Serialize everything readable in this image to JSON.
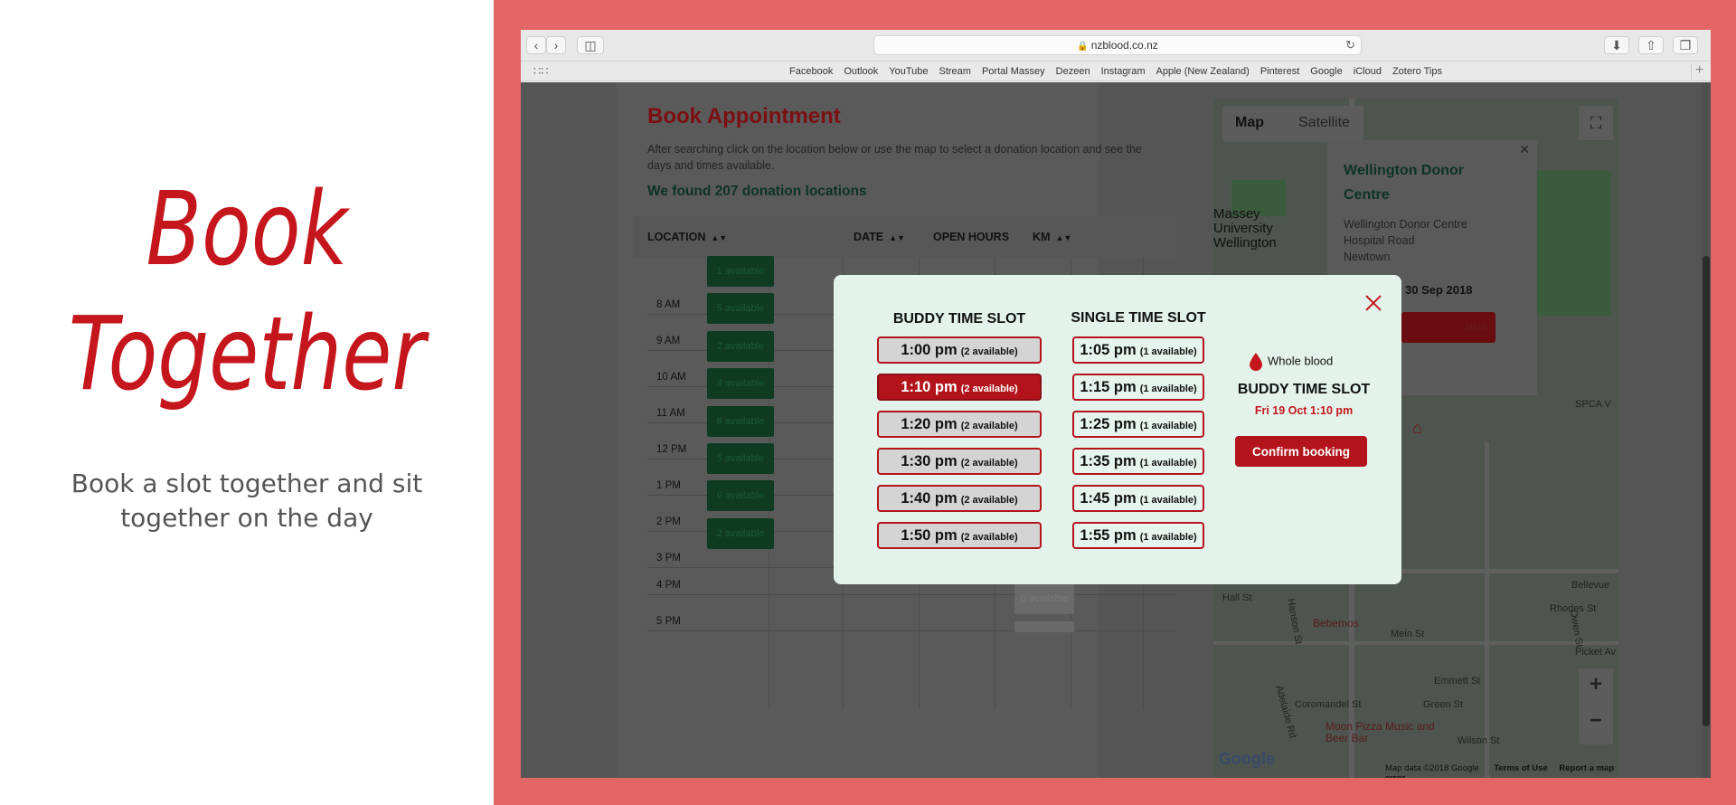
{
  "hero": {
    "line1": "Book",
    "line2": "Together",
    "tagline": "Book a slot together and sit together on the day"
  },
  "browser": {
    "url": "nzblood.co.nz",
    "bookmarks": [
      "Facebook",
      "Outlook",
      "YouTube",
      "Stream",
      "Portal Massey",
      "Dezeen",
      "Instagram",
      "Apple (New Zealand)",
      "Pinterest",
      "Google",
      "iCloud",
      "Zotero Tips"
    ]
  },
  "page": {
    "title": "Book Appointment",
    "description": "After searching click on the location below or use the map to select a donation location and see the days and times available.",
    "found": "We found 207 donation locations",
    "columns": [
      "LOCATION",
      "DATE",
      "OPEN HOURS",
      "KM"
    ],
    "hours": [
      "8 AM",
      "9 AM",
      "10 AM",
      "11 AM",
      "12 PM",
      "1 PM",
      "2 PM",
      "3 PM",
      "4 PM",
      "5 PM"
    ],
    "availability": [
      "1 available",
      "5 available",
      "2 available",
      "4 available",
      "6 available",
      "5 available",
      "6 available",
      "2 available"
    ],
    "extra_availability": "0 available"
  },
  "map": {
    "type_map": "Map",
    "type_satellite": "Satellite",
    "info_name": "Wellington Donor Centre",
    "info_address": [
      "Wellington Donor Centre",
      "Hospital Road",
      "Newtown"
    ],
    "info_date": "30 Sep 2018",
    "info_button": "ation",
    "label_massey": "Massey University Wellington",
    "label_spca": "SPCA V",
    "label_bebemos": "Bebemos",
    "label_moon": "Moon Pizza Music and Beer Bar",
    "streets": [
      "Hall St",
      "Hanson St",
      "Mein St",
      "Coromandel St",
      "Green St",
      "Emmett St",
      "Wilson St",
      "Adelaide Rd",
      "Owen St",
      "Picket Av",
      "Bellevue",
      "Rhodes St"
    ],
    "zoom_in": "+",
    "zoom_out": "−",
    "google": "Google",
    "footer": [
      "Map data ©2018 Google",
      "Terms of Use",
      "Report a map error"
    ]
  },
  "modal": {
    "buddy_title": "BUDDY TIME SLOT",
    "single_title": "SINGLE TIME SLOT",
    "buddy_slots": [
      {
        "time": "1:00 pm",
        "avail": "(2 available)"
      },
      {
        "time": "1:10 pm",
        "avail": "(2 available)"
      },
      {
        "time": "1:20 pm",
        "avail": "(2 available)"
      },
      {
        "time": "1:30 pm",
        "avail": "(2 available)"
      },
      {
        "time": "1:40 pm",
        "avail": "(2 available)"
      },
      {
        "time": "1:50 pm",
        "avail": "(2 available)"
      }
    ],
    "single_slots": [
      {
        "time": "1:05 pm",
        "avail": "(1 available)"
      },
      {
        "time": "1:15 pm",
        "avail": "(1 available)"
      },
      {
        "time": "1:25 pm",
        "avail": "(1 available)"
      },
      {
        "time": "1:35 pm",
        "avail": "(1 available)"
      },
      {
        "time": "1:45 pm",
        "avail": "(1 available)"
      },
      {
        "time": "1:55 pm",
        "avail": "(1 available)"
      }
    ],
    "summary_blood": "Whole blood",
    "summary_title": "BUDDY TIME SLOT",
    "summary_time": "Fri 19 Oct 1:10 pm",
    "confirm_label": "Confirm booking"
  },
  "colors": {
    "accent": "#c4161c",
    "modal_bg": "#e3f3ec",
    "side_bg": "#e36666"
  },
  "icons": [
    "back-icon",
    "forward-icon",
    "sidebar-icon",
    "lock-icon",
    "reload-icon",
    "download-icon",
    "share-icon",
    "tabs-icon",
    "apps-grid-icon",
    "add-tab-icon",
    "sort-icon",
    "fullscreen-icon",
    "close-icon",
    "blood-drop-icon",
    "map-pin-icon"
  ]
}
